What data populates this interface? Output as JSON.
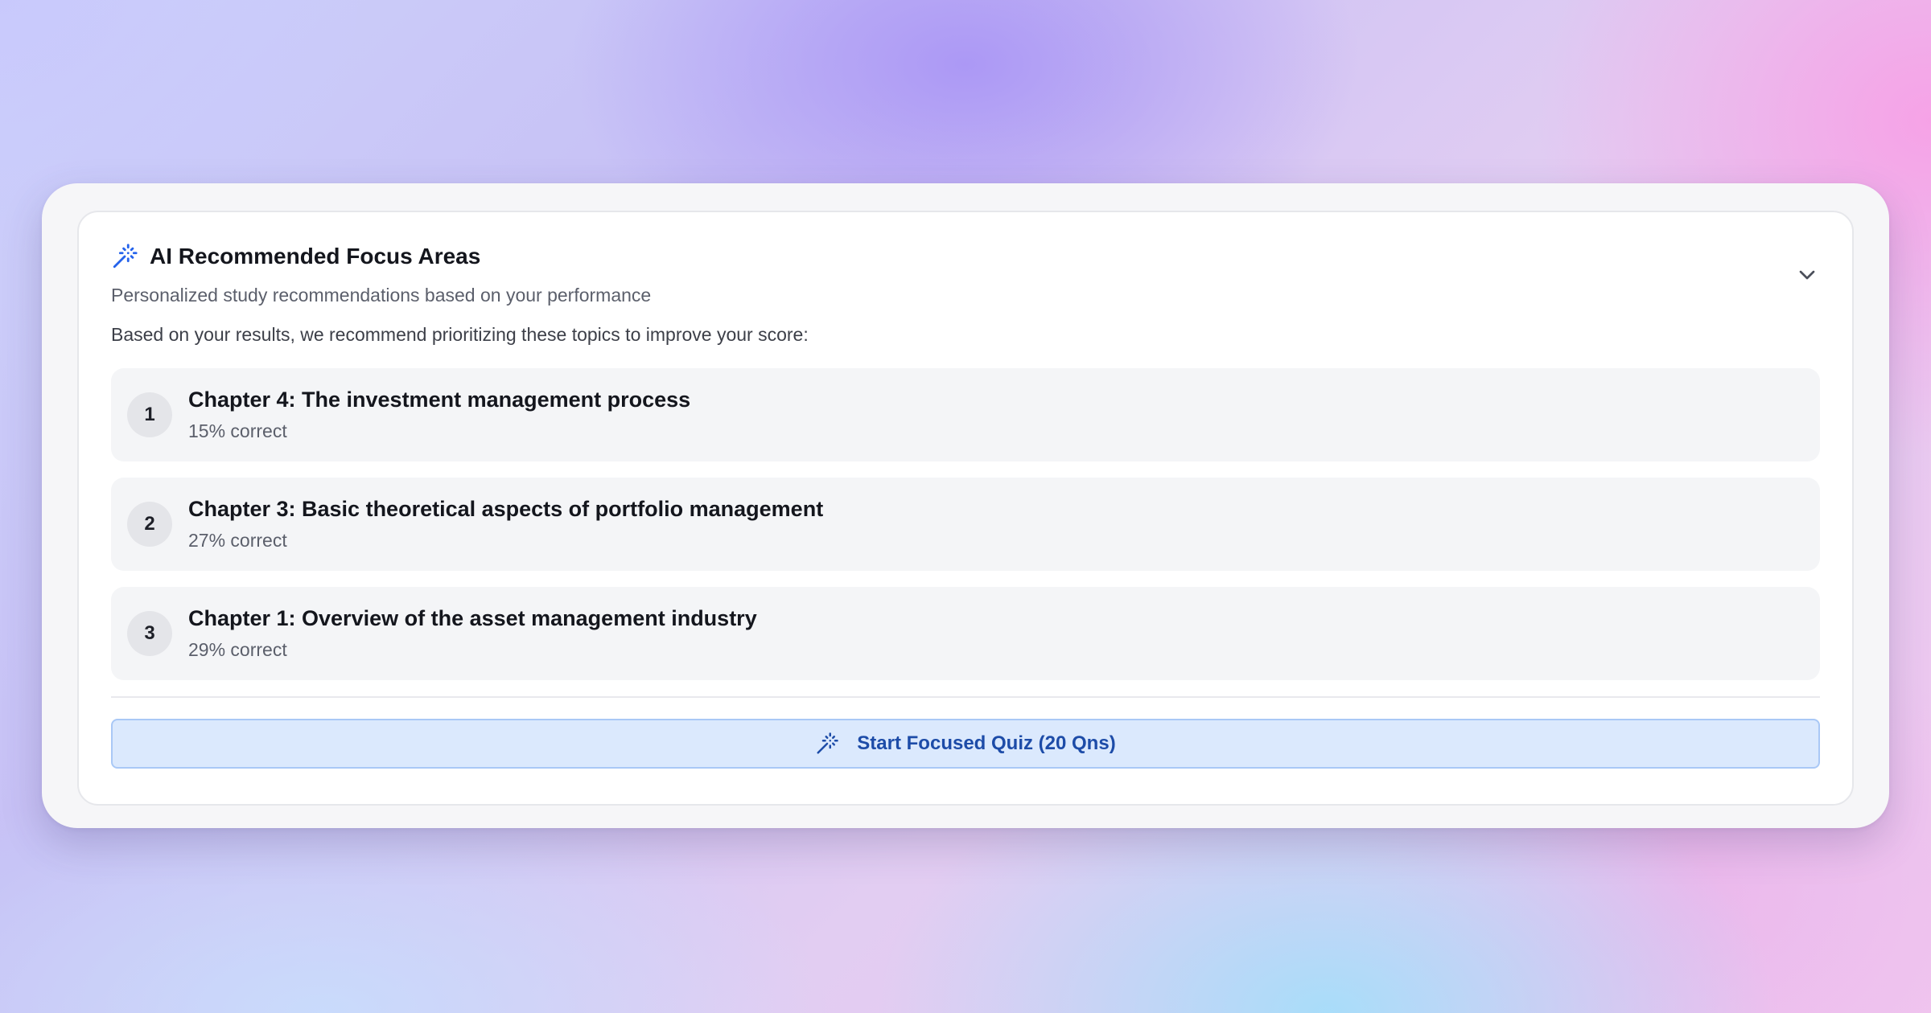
{
  "card": {
    "title": "AI Recommended Focus Areas",
    "description": "Personalized study recommendations based on your performance",
    "intro": "Based on your results, we recommend prioritizing these topics to improve your score:",
    "icons": {
      "title_icon": "magic-wand-icon",
      "collapse_icon": "chevron-down-icon"
    }
  },
  "recommendations": [
    {
      "rank": "1",
      "title": "Chapter 4: The investment management process",
      "score": "15% correct"
    },
    {
      "rank": "2",
      "title": "Chapter 3: Basic theoretical aspects of portfolio management",
      "score": "27% correct"
    },
    {
      "rank": "3",
      "title": "Chapter 1: Overview of the asset management industry",
      "score": "29% correct"
    }
  ],
  "cta": {
    "label": "Start Focused Quiz (20 Qns)",
    "icon": "magic-wand-icon"
  },
  "colors": {
    "accent": "#2563eb",
    "cta_background": "#dbe9fd",
    "cta_text": "#1d4ca8"
  }
}
